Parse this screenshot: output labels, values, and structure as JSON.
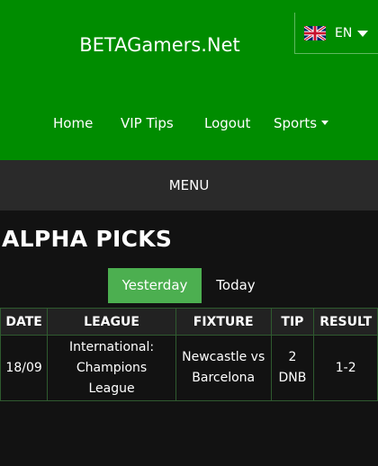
{
  "header": {
    "site_title": "BETAGamers.Net",
    "language": {
      "code": "EN",
      "flag_icon": "uk-flag-icon"
    },
    "nav": [
      {
        "label": "Home"
      },
      {
        "label": "VIP Tips"
      },
      {
        "label": "Logout"
      },
      {
        "label": "Sports"
      }
    ],
    "colors": {
      "brand_green": "#008c00",
      "active_tab": "#4caf50"
    }
  },
  "menu_bar": {
    "label": "MENU"
  },
  "main": {
    "title": "ALPHA PICKS",
    "tabs": [
      {
        "label": "Yesterday",
        "active": true
      },
      {
        "label": "Today",
        "active": false
      }
    ],
    "table": {
      "headers": [
        "DATE",
        "LEAGUE",
        "FIXTURE",
        "TIP",
        "RESULT"
      ],
      "rows": [
        [
          "18/09",
          "International: Champions League",
          "Newcastle vs Barcelona",
          "2 DNB",
          "1-2"
        ]
      ]
    }
  }
}
